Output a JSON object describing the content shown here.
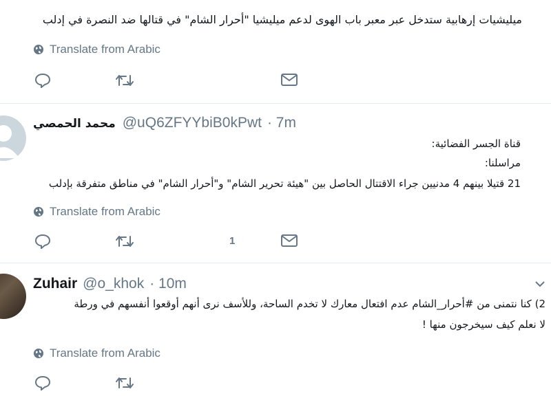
{
  "translate_label": "Translate from Arabic",
  "tweets": [
    {
      "lines": [
        "ميليشيات إرهابية ستدخل عبر معبر باب الهوى لدعم ميليشيا \"أحرار الشام\" في قتالها ضد النصرة في إدلب"
      ],
      "reply_count": "",
      "retweet_count": "",
      "like_count": ""
    },
    {
      "name": "محمد الحمصي",
      "handle": "@uQ6ZFYYbiB0kPwt",
      "time": "· 7m",
      "lines": [
        "قناة الجسر الفضائية:",
        "مراسلنا:",
        "21 قتيلا بينهم 4 مدنيين جراء الاقتتال الحاصل بين \"هيئة تحرير الشام\" و\"أحرار الشام\" في مناطق متفرقة بإدلب"
      ],
      "like_count": "1"
    },
    {
      "name": "Zuhair",
      "handle": "@o_khok",
      "time": "· 10m",
      "lines": [
        "2) كنا نتمنى من #أحرار_الشام عدم افتعال معارك لا تخدم الساحة، وللأسف نرى أنهم أوقعوا أنفسهم في ورطة",
        "لا نعلم كيف سيخرجون منها !"
      ]
    }
  ],
  "colors": {
    "muted": "#657786",
    "link": "#1b95e0",
    "divider": "#e6ecf0"
  },
  "icons": [
    "globe-icon",
    "reply-icon",
    "retweet-icon",
    "like-icon",
    "message-icon",
    "chevron-down-icon"
  ]
}
